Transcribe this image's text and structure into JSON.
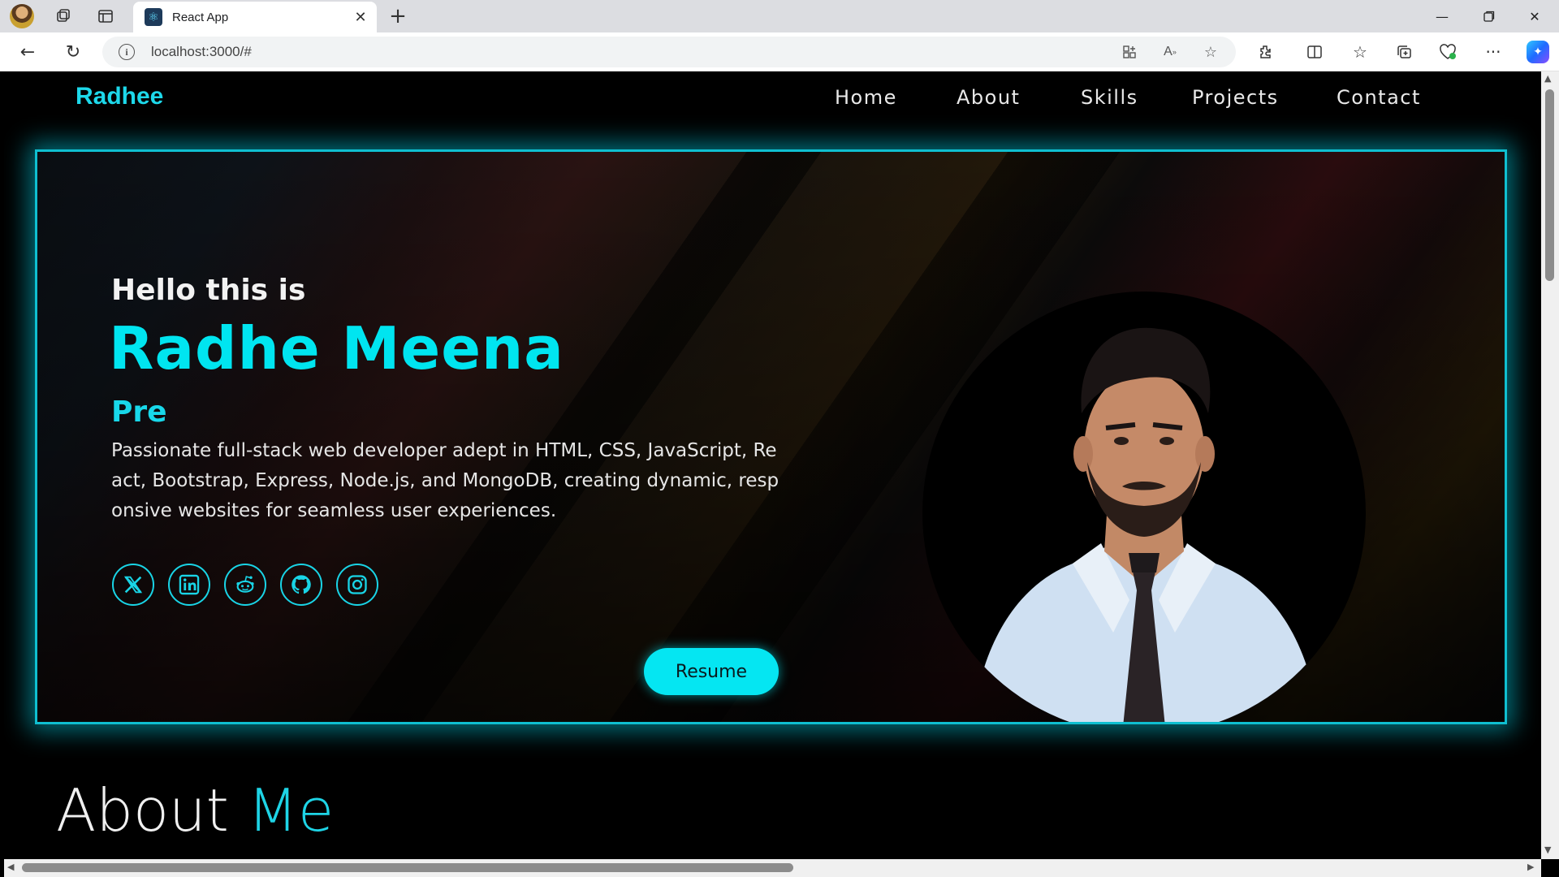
{
  "browser": {
    "tab_title": "React App",
    "tab_favicon": "react-icon",
    "url": "localhost:3000/#",
    "toolbar_icons": [
      "workspaces-icon",
      "vertical-tabs-icon",
      "new-tab-icon",
      "back-icon",
      "refresh-icon",
      "site-info-icon",
      "app-available-icon",
      "read-aloud-icon",
      "favorite-star-icon",
      "extensions-icon",
      "split-screen-icon",
      "favorites-icon",
      "collections-icon",
      "browser-essentials-icon",
      "more-icon",
      "copilot-icon"
    ],
    "window_controls": [
      "minimize-icon",
      "restore-icon",
      "close-icon"
    ]
  },
  "nav": {
    "brand": "Radhee",
    "links": [
      "Home",
      "About",
      "Skills",
      "Projects",
      "Contact"
    ]
  },
  "hero": {
    "greeting": "Hello this is",
    "name": "Radhe Meena",
    "typed_text": "Pre",
    "bio": "Passionate full-stack web developer adept in HTML, CSS, JavaScript, React, Bootstrap, Express, Node.js, and MongoDB, creating dynamic, responsive websites for seamless user experiences.",
    "social_icons": [
      "x-twitter-icon",
      "linkedin-icon",
      "reddit-icon",
      "github-icon",
      "instagram-icon"
    ],
    "resume_label": "Resume",
    "accent_color": "#00e5f0"
  },
  "about": {
    "title_white": "About",
    "title_accent": "Me"
  }
}
